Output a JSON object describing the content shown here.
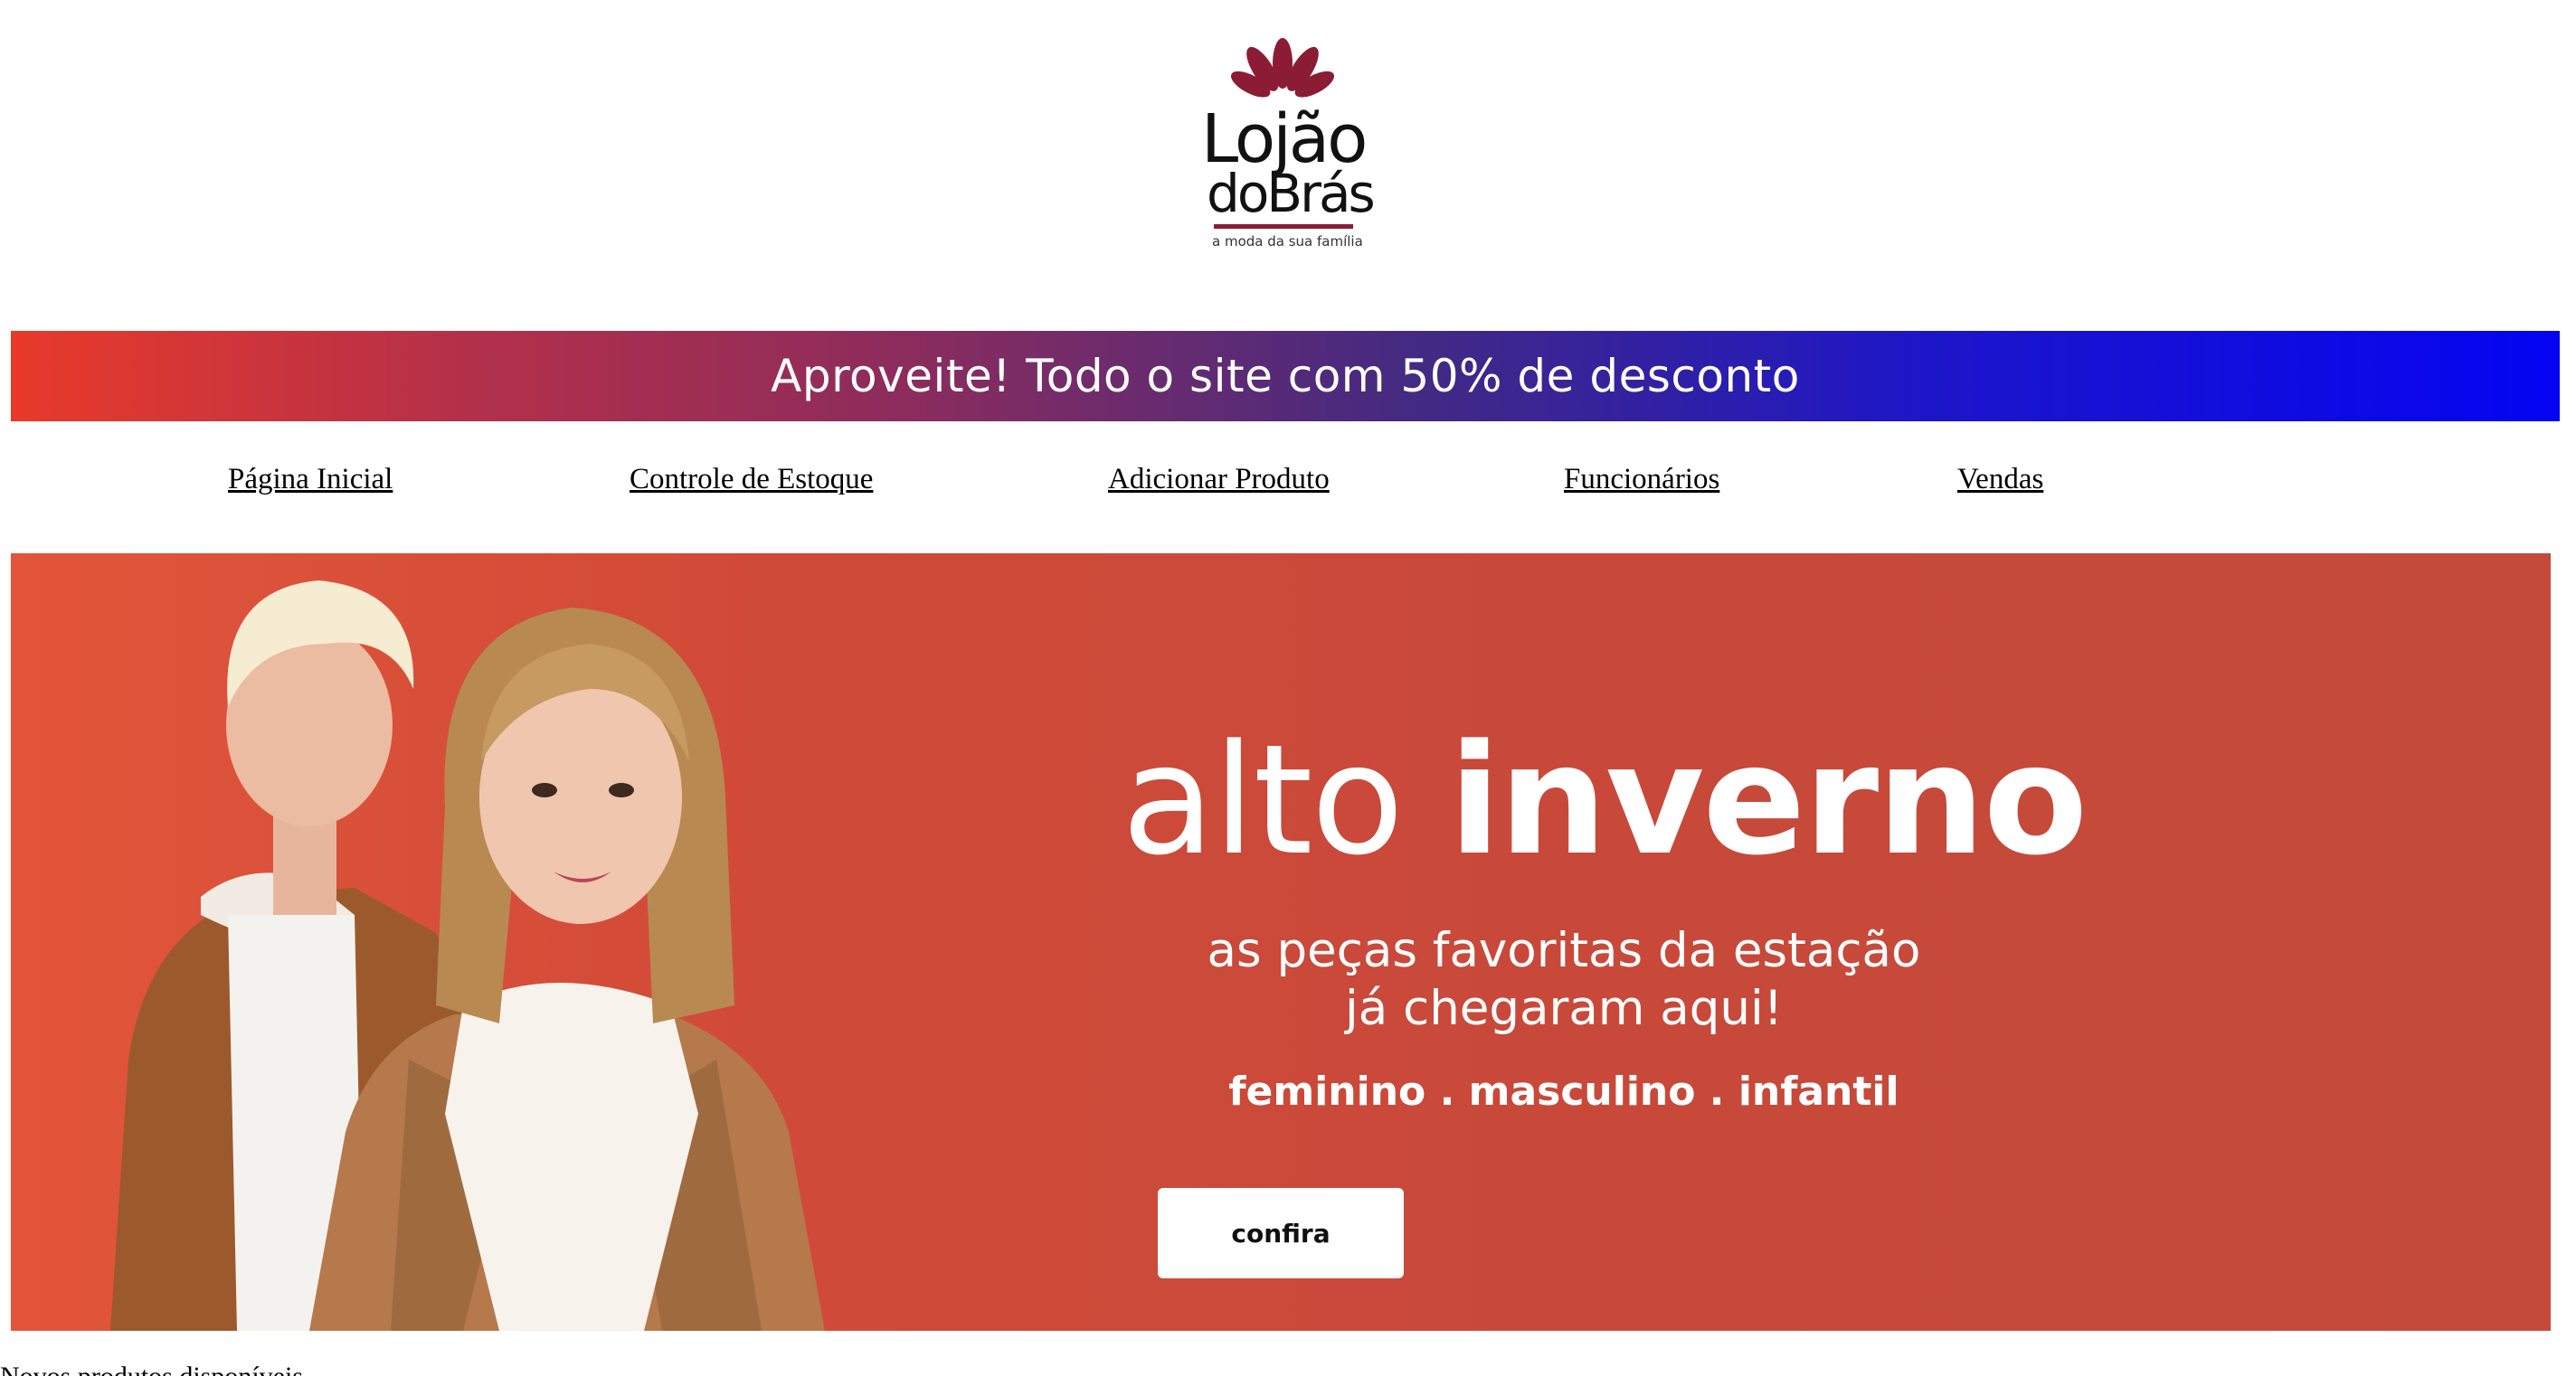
{
  "brand": {
    "logo_line1": "Lojão",
    "logo_line2": "doBrás",
    "tagline": "a moda da sua família",
    "accent_color": "#8c1c36"
  },
  "promo": {
    "text": "Aproveite! Todo o site com 50% de desconto"
  },
  "nav": {
    "items": [
      {
        "label": "Página Inicial"
      },
      {
        "label": "Controle de Estoque"
      },
      {
        "label": "Adicionar Produto"
      },
      {
        "label": "Funcionários"
      },
      {
        "label": "Vendas"
      }
    ]
  },
  "hero": {
    "title_light": "alto",
    "title_bold": "inverno",
    "subtitle_line1": "as peças favoritas da estação",
    "subtitle_line2": "já chegaram aqui!",
    "categories": "feminino . masculino . infantil",
    "cta_label": "confira",
    "background_color": "#c8493a"
  },
  "below_fold": {
    "text": "Novos produtos disponíveis"
  }
}
